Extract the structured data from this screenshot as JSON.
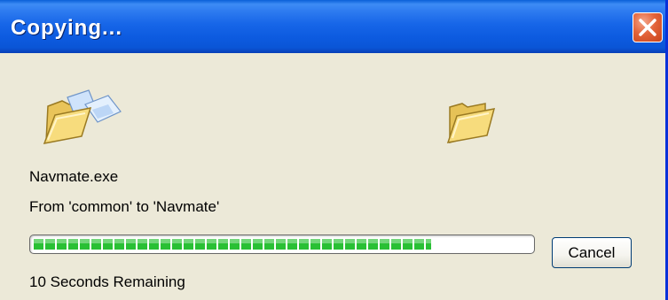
{
  "window": {
    "title": "Copying...",
    "close_icon": "close-icon"
  },
  "animation": {
    "source_icon": "folder-with-flying-paper-icon",
    "destination_icon": "open-folder-icon"
  },
  "copy": {
    "file_name": "Navmate.exe",
    "from_to": "From 'common' to 'Navmate'",
    "progress": 0.8,
    "time_remaining": "10 Seconds Remaining"
  },
  "buttons": {
    "cancel_label": "Cancel"
  },
  "colors": {
    "titlebar": "#0a55d6",
    "background": "#ece9d8",
    "progress_fill": "#29c034",
    "close_button": "#e3643b"
  }
}
